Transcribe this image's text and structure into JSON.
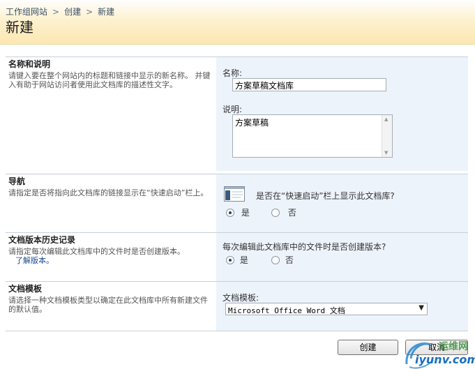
{
  "breadcrumb": {
    "items": [
      "工作组网站",
      "创建",
      "新建"
    ],
    "separator": ">"
  },
  "page": {
    "title": "新建"
  },
  "sections": {
    "name": {
      "title": "名称和说明",
      "description": "请键入要在整个网站内的标题和链接中显示的新名称。 并键入有助于网站访问者使用此文档库的描述性文字。",
      "name_label": "名称:",
      "name_value": "方案草稿文档库",
      "desc_label": "说明:",
      "desc_value": "方案草稿"
    },
    "navigation": {
      "title": "导航",
      "description": "请指定是否将指向此文档库的链接显示在“快速启动”栏上。",
      "question": "是否在“快速启动”栏上显示此文档库?",
      "yes": "是",
      "no": "否",
      "selected": "yes"
    },
    "versioning": {
      "title": "文档版本历史记录",
      "description": "请指定每次编辑此文档库中的文件时是否创建版本。",
      "link": "了解版本。",
      "question": "每次编辑此文档库中的文件时是否创建版本?",
      "yes": "是",
      "no": "否",
      "selected": "yes"
    },
    "template": {
      "title": "文档模板",
      "description": "请选择一种文档模板类型以确定在此文档库中所有新建文件的默认值。",
      "label": "文档模板:",
      "selected": "Microsoft Office Word 文档"
    }
  },
  "buttons": {
    "create": "创建",
    "cancel": "取消"
  },
  "watermark": {
    "text": "运维网",
    "url": "iyunv.com"
  },
  "colors": {
    "header_accent": "#fbe7b0",
    "right_panel": "#edf3fb",
    "link": "#1a4a8a"
  }
}
